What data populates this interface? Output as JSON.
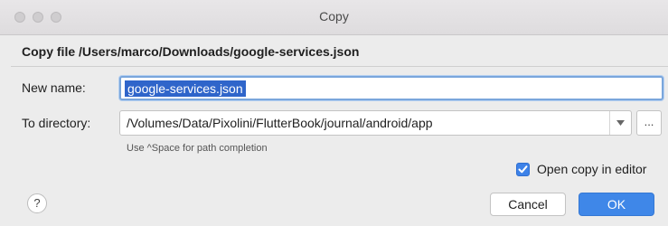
{
  "window": {
    "title": "Copy"
  },
  "dialog": {
    "header": "Copy file /Users/marco/Downloads/google-services.json",
    "new_name_label": "New name:",
    "new_name_value": "google-services.json",
    "to_directory_label": "To directory:",
    "to_directory_value": "/Volumes/Data/Pixolini/FlutterBook/journal/android/app",
    "browse_label": "...",
    "hint": "Use ^Space for path completion",
    "open_copy_label": "Open copy in editor",
    "open_copy_checked": true,
    "help_label": "?",
    "cancel_label": "Cancel",
    "ok_label": "OK"
  },
  "colors": {
    "accent": "#3f87e8",
    "selection": "#2f65ca"
  }
}
